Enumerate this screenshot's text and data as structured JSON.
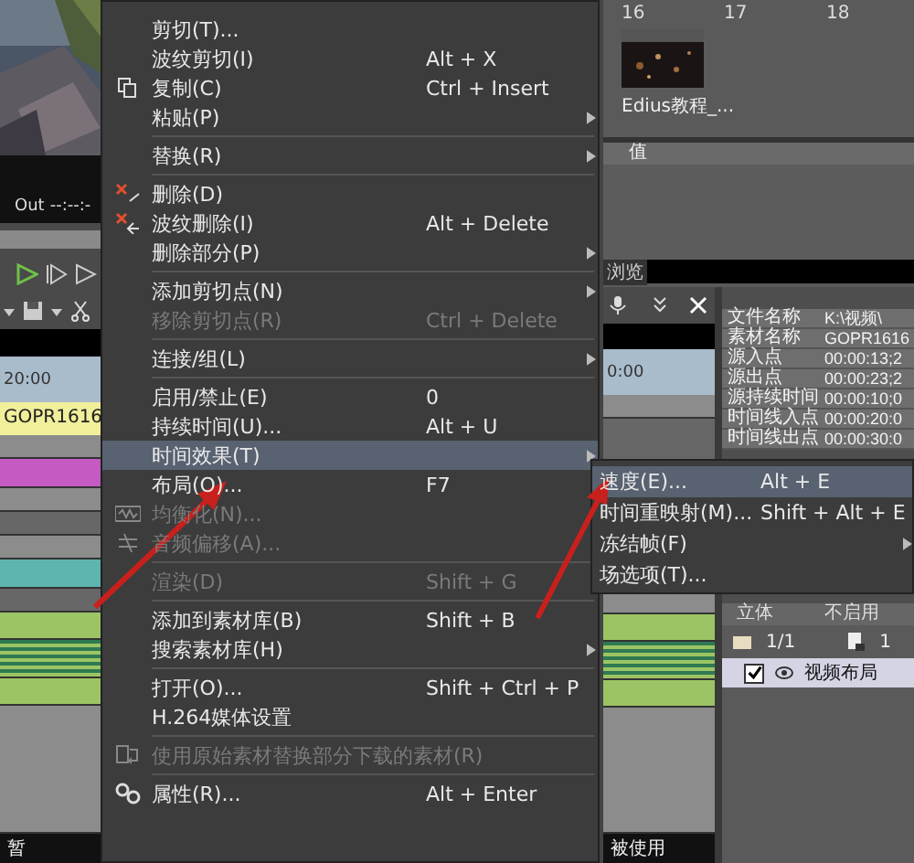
{
  "viewer": {
    "out_label": "Out",
    "out_timecode": "--:--:-"
  },
  "timeline": {
    "ruler_time": "20:00",
    "clip": "GOPR1616",
    "status": "暂"
  },
  "bin": {
    "columns": [
      "16",
      "17",
      "18"
    ],
    "clip_name": "Edius教程_...",
    "value_header": "值"
  },
  "preview_tab": "浏览",
  "track_panel": {
    "ruler_time": "0:00"
  },
  "properties": [
    {
      "name": "文件名称",
      "value": "K:\\视频\\"
    },
    {
      "name": "素材名称",
      "value": "GOPR1616"
    },
    {
      "name": "源入点",
      "value": "00:00:13;2"
    },
    {
      "name": "源出点",
      "value": "00:00:23;2"
    },
    {
      "name": "源持续时间",
      "value": "00:00:10;0"
    },
    {
      "name": "时间线入点",
      "value": "00:00:20:0"
    },
    {
      "name": "时间线出点",
      "value": "00:00:30:0"
    }
  ],
  "layout_panel": {
    "columns": [
      "立体",
      "不启用"
    ],
    "page": "1/1",
    "count": "1",
    "items": [
      {
        "label": "视频布局",
        "checked": true
      }
    ]
  },
  "status": "被使用",
  "context_menu": {
    "groups": [
      [
        {
          "label": "剪切(T)...",
          "kind": "plain",
          "disabled": false,
          "selected": false,
          "has_submenu": false
        },
        {
          "label": "波纹剪切(I)",
          "shortcut": "Alt + X",
          "kind": "plain",
          "disabled": false,
          "selected": false,
          "has_submenu": false
        },
        {
          "label": "复制(C)",
          "shortcut": "Ctrl + Insert",
          "kind": "copy",
          "disabled": false,
          "selected": false,
          "has_submenu": false
        },
        {
          "label": "粘贴(P)",
          "kind": "plain",
          "disabled": false,
          "selected": false,
          "has_submenu": true
        }
      ],
      [
        {
          "label": "替换(R)",
          "kind": "plain",
          "disabled": false,
          "selected": false,
          "has_submenu": true
        }
      ],
      [
        {
          "label": "删除(D)",
          "kind": "delete",
          "disabled": false,
          "selected": false,
          "has_submenu": false
        },
        {
          "label": "波纹删除(I)",
          "shortcut": "Alt + Delete",
          "kind": "ripple_delete",
          "disabled": false,
          "selected": false,
          "has_submenu": false
        },
        {
          "label": "删除部分(P)",
          "kind": "plain",
          "disabled": false,
          "selected": false,
          "has_submenu": true
        }
      ],
      [
        {
          "label": "添加剪切点(N)",
          "kind": "plain",
          "disabled": false,
          "selected": false,
          "has_submenu": true
        },
        {
          "label": "移除剪切点(R)",
          "shortcut": "Ctrl + Delete",
          "kind": "plain",
          "disabled": true,
          "selected": false,
          "has_submenu": false
        }
      ],
      [
        {
          "label": "连接/组(L)",
          "kind": "plain",
          "disabled": false,
          "selected": false,
          "has_submenu": true
        }
      ],
      [
        {
          "label": "启用/禁止(E)",
          "shortcut": "0",
          "kind": "plain",
          "disabled": false,
          "selected": false,
          "has_submenu": false
        },
        {
          "label": "持续时间(U)...",
          "shortcut": "Alt + U",
          "kind": "plain",
          "disabled": false,
          "selected": false,
          "has_submenu": false
        },
        {
          "label": "时间效果(T)",
          "kind": "plain",
          "disabled": false,
          "selected": true,
          "has_submenu": true
        },
        {
          "label": "布局(O)...",
          "shortcut": "F7",
          "kind": "plain",
          "disabled": false,
          "selected": false,
          "has_submenu": false
        },
        {
          "label": "均衡化(N)...",
          "kind": "equalize",
          "disabled": true,
          "selected": false,
          "has_submenu": false
        },
        {
          "label": "音频偏移(A)...",
          "kind": "audio_offset",
          "disabled": true,
          "selected": false,
          "has_submenu": false
        }
      ],
      [
        {
          "label": "渲染(D)",
          "shortcut": "Shift + G",
          "kind": "plain",
          "disabled": true,
          "selected": false,
          "has_submenu": false
        }
      ],
      [
        {
          "label": "添加到素材库(B)",
          "shortcut": "Shift + B",
          "kind": "plain",
          "disabled": false,
          "selected": false,
          "has_submenu": false
        },
        {
          "label": "搜索素材库(H)",
          "kind": "plain",
          "disabled": false,
          "selected": false,
          "has_submenu": true
        }
      ],
      [
        {
          "label": "打开(O)...",
          "shortcut": "Shift + Ctrl + P",
          "kind": "plain",
          "disabled": false,
          "selected": false,
          "has_submenu": false
        },
        {
          "label": "H.264媒体设置",
          "kind": "plain",
          "disabled": false,
          "selected": false,
          "has_submenu": false
        }
      ],
      [
        {
          "label": "使用原始素材替换部分下载的素材(R)",
          "kind": "replace_source",
          "disabled": true,
          "selected": false,
          "has_submenu": false
        }
      ],
      [
        {
          "label": "属性(R)...",
          "shortcut": "Alt + Enter",
          "kind": "properties",
          "disabled": false,
          "selected": false,
          "has_submenu": false
        }
      ]
    ]
  },
  "time_effect_submenu": {
    "items": [
      {
        "label": "速度(E)...",
        "shortcut": "Alt + E",
        "selected": true,
        "has_submenu": false
      },
      {
        "label": "时间重映射(M)...",
        "shortcut": "Shift + Alt + E",
        "selected": false,
        "has_submenu": false
      },
      {
        "label": "冻结帧(F)",
        "selected": false,
        "has_submenu": true
      },
      {
        "label": "场选项(T)...",
        "selected": false,
        "has_submenu": false
      }
    ]
  }
}
